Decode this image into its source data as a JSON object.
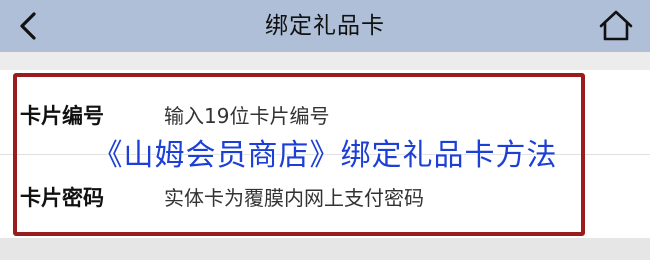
{
  "header": {
    "title": "绑定礼品卡",
    "back_icon": "chevron-left-icon",
    "home_icon": "home-icon",
    "background": "#aebfd7"
  },
  "form": {
    "card_number_label": "卡片编号",
    "card_number_placeholder": "输入19位卡片编号",
    "card_password_label": "卡片密码",
    "card_password_placeholder": "实体卡为覆膜内网上支付密码"
  },
  "overlay": {
    "caption": "《山姆会员商店》绑定礼品卡方法",
    "caption_color": "#1c3fd6",
    "highlight_color": "#9b1c1c"
  }
}
